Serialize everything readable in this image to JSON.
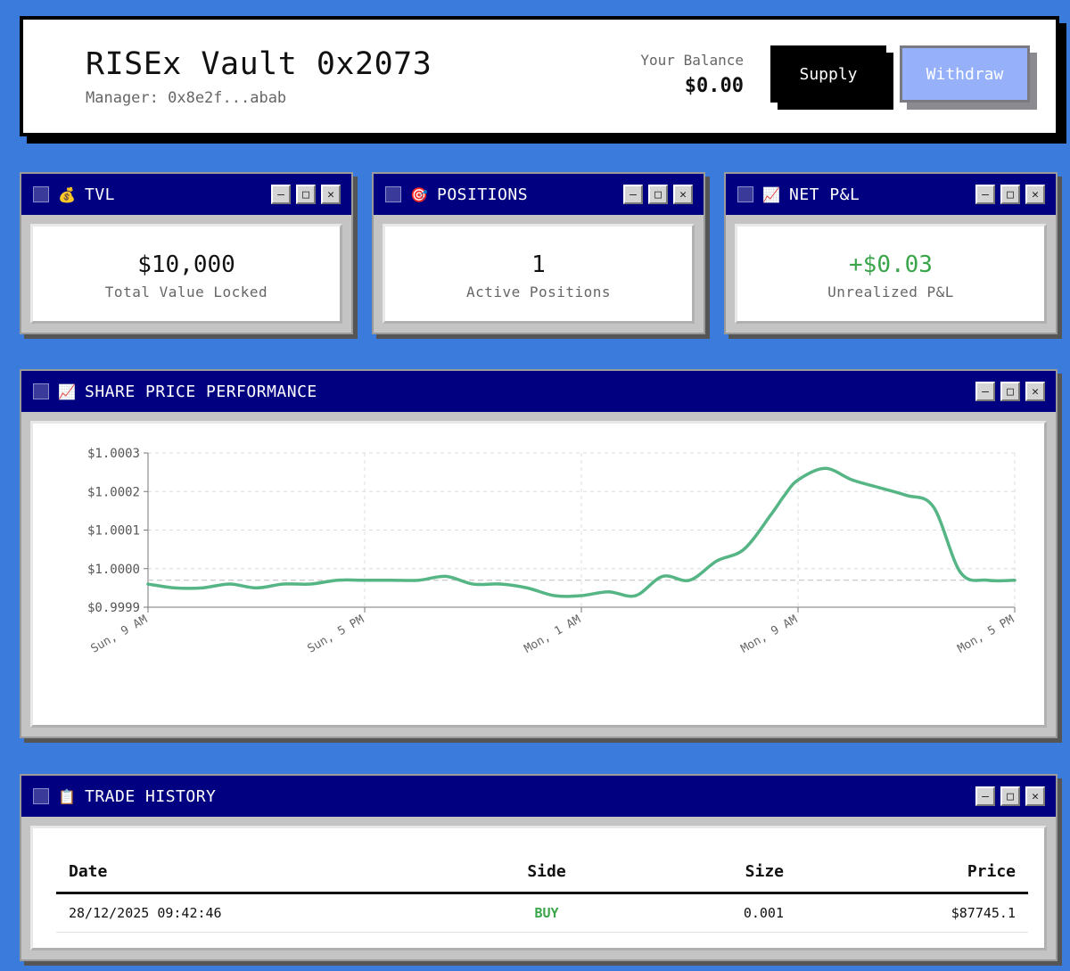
{
  "header": {
    "title": "RISEx Vault 0x2073",
    "manager": "Manager: 0x8e2f...abab",
    "balance_label": "Your Balance",
    "balance_value": "$0.00",
    "supply_label": "Supply",
    "withdraw_label": "Withdraw"
  },
  "window_controls": {
    "minimize": "–",
    "maximize": "□",
    "close": "✕"
  },
  "cards": {
    "tvl": {
      "title": "TVL",
      "icon": "money-bag-icon",
      "value": "$10,000",
      "label": "Total Value Locked"
    },
    "positions": {
      "title": "POSITIONS",
      "icon": "target-icon",
      "value": "1",
      "label": "Active Positions"
    },
    "pnl": {
      "title": "NET P&L",
      "icon": "chart-up-icon",
      "value": "+$0.03",
      "label": "Unrealized P&L",
      "value_color": "#3aa54a"
    }
  },
  "chart_window": {
    "title": "SHARE PRICE PERFORMANCE",
    "icon": "chart-up-icon"
  },
  "chart_data": {
    "type": "line",
    "title": "",
    "xlabel": "",
    "ylabel": "",
    "x_ticks": [
      "Sun, 9 AM",
      "Sun, 5 PM",
      "Mon, 1 AM",
      "Mon, 9 AM",
      "Mon, 5 PM"
    ],
    "y_ticks": [
      "$1.0003",
      "$1.0002",
      "$1.0001",
      "$1.0000",
      "$0.9999"
    ],
    "xlim": [
      0,
      32
    ],
    "ylim": [
      0.9999,
      1.0003
    ],
    "reference_line": 0.99997,
    "grid": true,
    "line_color": "#55b585",
    "series": [
      {
        "x": [
          0,
          1,
          2,
          3,
          4,
          5,
          6,
          7,
          8,
          9,
          10,
          11,
          12,
          13,
          14,
          15,
          16,
          17,
          18,
          19,
          20,
          21,
          22,
          23,
          23.5,
          24,
          25,
          26,
          27,
          28,
          29,
          30,
          31,
          32
        ],
        "y": [
          0.99996,
          0.99995,
          0.99995,
          0.99996,
          0.99995,
          0.99996,
          0.99996,
          0.99997,
          0.99997,
          0.99997,
          0.99997,
          0.99998,
          0.99996,
          0.99996,
          0.99995,
          0.99993,
          0.99993,
          0.99994,
          0.99993,
          0.99998,
          0.99997,
          1.00002,
          1.00005,
          1.00014,
          1.00019,
          1.00023,
          1.00026,
          1.00023,
          1.00021,
          1.00019,
          1.00016,
          0.99999,
          0.99997,
          0.99997
        ]
      }
    ]
  },
  "trade_window": {
    "title": "TRADE HISTORY",
    "icon": "clipboard-icon"
  },
  "trade_table": {
    "columns": [
      "Date",
      "Side",
      "Size",
      "Price"
    ],
    "rows": [
      {
        "date": "28/12/2025 09:42:46",
        "side": "BUY",
        "size": "0.001",
        "price": "$87745.1"
      }
    ]
  }
}
